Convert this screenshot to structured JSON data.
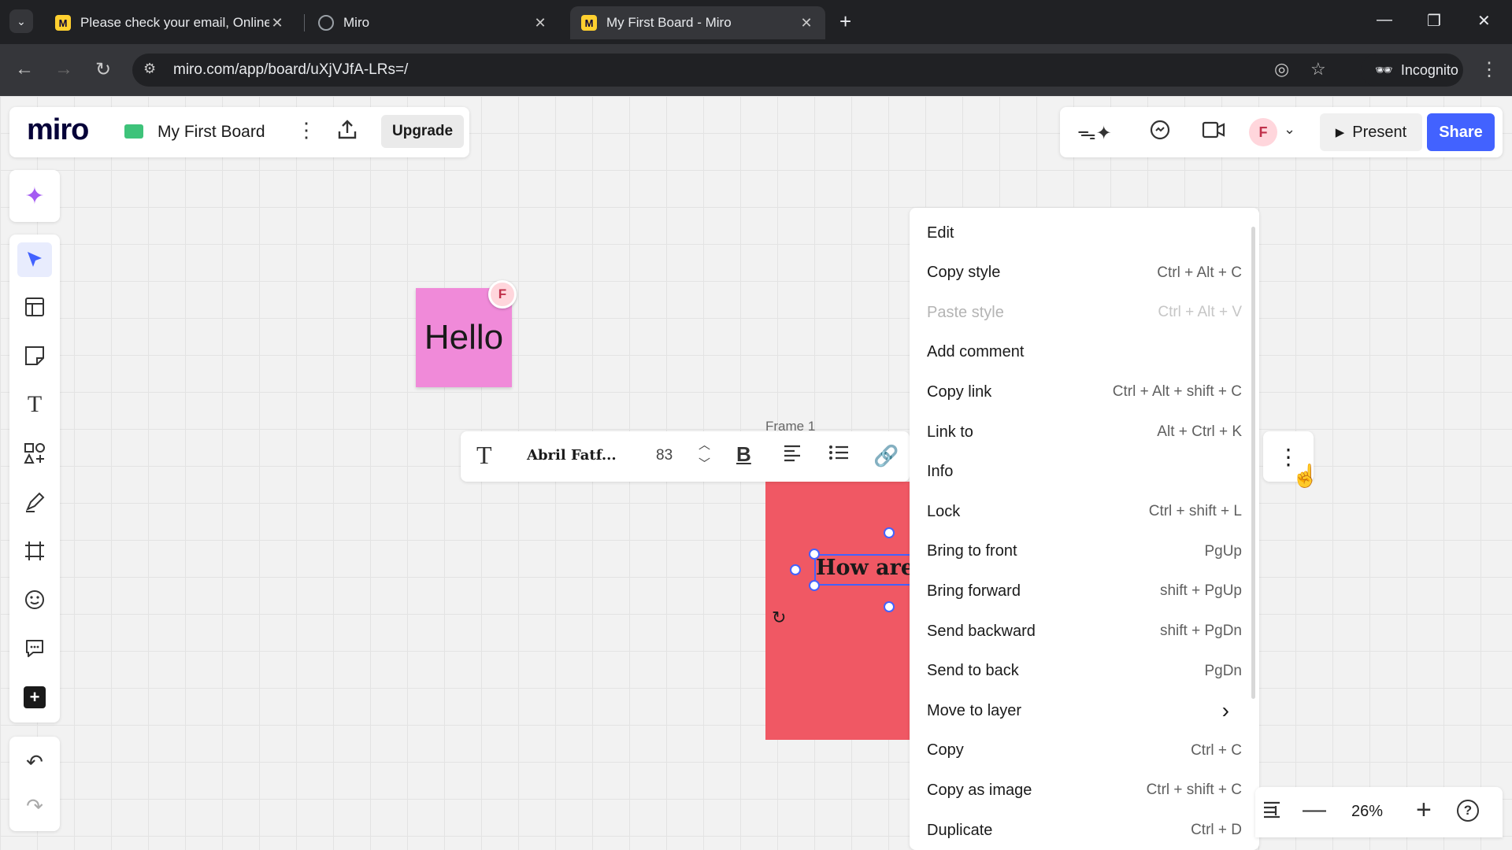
{
  "browser": {
    "tabs": [
      {
        "title": "Please check your email, Online",
        "active": false
      },
      {
        "title": "Miro",
        "active": false
      },
      {
        "title": "My First Board - Miro",
        "active": true
      }
    ],
    "url": "miro.com/app/board/uXjVJfA-LRs=/",
    "incognito_label": "Incognito"
  },
  "header": {
    "logo": "miro",
    "board_name": "My First Board",
    "upgrade_label": "Upgrade",
    "avatar_initial": "F",
    "present_label": "Present",
    "share_label": "Share"
  },
  "board": {
    "sticky_text": "Hello",
    "sticky_avatar": "F",
    "frame_label": "Frame 1",
    "frame_text": "How are",
    "colors": {
      "sticky": "#f08ad9",
      "frame": "#f05864",
      "accent": "#4262ff"
    }
  },
  "text_toolbar": {
    "font": "Abril Fatf...",
    "size": "83"
  },
  "context_menu": [
    {
      "label": "Edit",
      "shortcut": "",
      "enabled": true
    },
    {
      "label": "Copy style",
      "shortcut": "Ctrl + Alt + C",
      "enabled": true
    },
    {
      "label": "Paste style",
      "shortcut": "Ctrl + Alt + V",
      "enabled": false
    },
    {
      "label": "Add comment",
      "shortcut": "",
      "enabled": true
    },
    {
      "label": "Copy link",
      "shortcut": "Ctrl + Alt + shift + C",
      "enabled": true
    },
    {
      "label": "Link to",
      "shortcut": "Alt + Ctrl + K",
      "enabled": true
    },
    {
      "label": "Info",
      "shortcut": "",
      "enabled": true
    },
    {
      "label": "Lock",
      "shortcut": "Ctrl + shift + L",
      "enabled": true
    },
    {
      "label": "Bring to front",
      "shortcut": "PgUp",
      "enabled": true
    },
    {
      "label": "Bring forward",
      "shortcut": "shift + PgUp",
      "enabled": true
    },
    {
      "label": "Send backward",
      "shortcut": "shift + PgDn",
      "enabled": true
    },
    {
      "label": "Send to back",
      "shortcut": "PgDn",
      "enabled": true
    },
    {
      "label": "Move to layer",
      "shortcut": "›",
      "enabled": true
    },
    {
      "label": "Copy",
      "shortcut": "Ctrl + C",
      "enabled": true
    },
    {
      "label": "Copy as image",
      "shortcut": "Ctrl + shift + C",
      "enabled": true
    },
    {
      "label": "Duplicate",
      "shortcut": "Ctrl + D",
      "enabled": true
    }
  ],
  "zoom": {
    "level": "26%"
  }
}
